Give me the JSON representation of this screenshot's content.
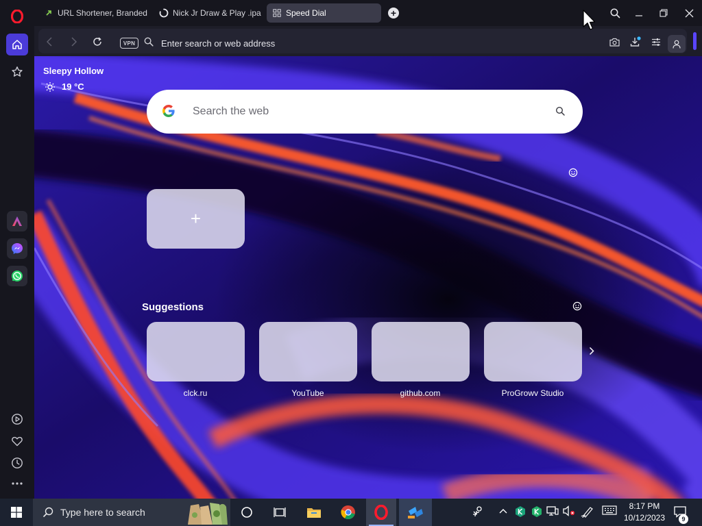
{
  "tabs": [
    {
      "title": "URL Shortener, Branded S",
      "icon": "green-arrow-favicon-icon"
    },
    {
      "title": "Nick Jr Draw & Play .ipa f",
      "icon": "loading-spinner-icon"
    },
    {
      "title": "Speed Dial",
      "icon": "grid-favicon-icon",
      "active": true
    }
  ],
  "address_bar": {
    "vpn_label": "VPN",
    "placeholder": "Enter search or web address"
  },
  "weather": {
    "location": "Sleepy Hollow",
    "temperature": "19 °C"
  },
  "search": {
    "placeholder": "Search the web"
  },
  "speed_dial": {
    "add_label": "+"
  },
  "suggestions": {
    "title": "Suggestions",
    "items": [
      {
        "label": "clck.ru"
      },
      {
        "label": "YouTube"
      },
      {
        "label": "github.com"
      },
      {
        "label": "ProGrowv Studio"
      }
    ]
  },
  "taskbar": {
    "search_placeholder": "Type here to search",
    "time": "8:17 PM",
    "date": "10/12/2023",
    "notification_count": "9"
  },
  "colors": {
    "accent": "#4b3bd8",
    "opera_red": "#ff1b2d",
    "background_purple": "#3b2ad6",
    "background_orange": "#ff5a2a"
  }
}
